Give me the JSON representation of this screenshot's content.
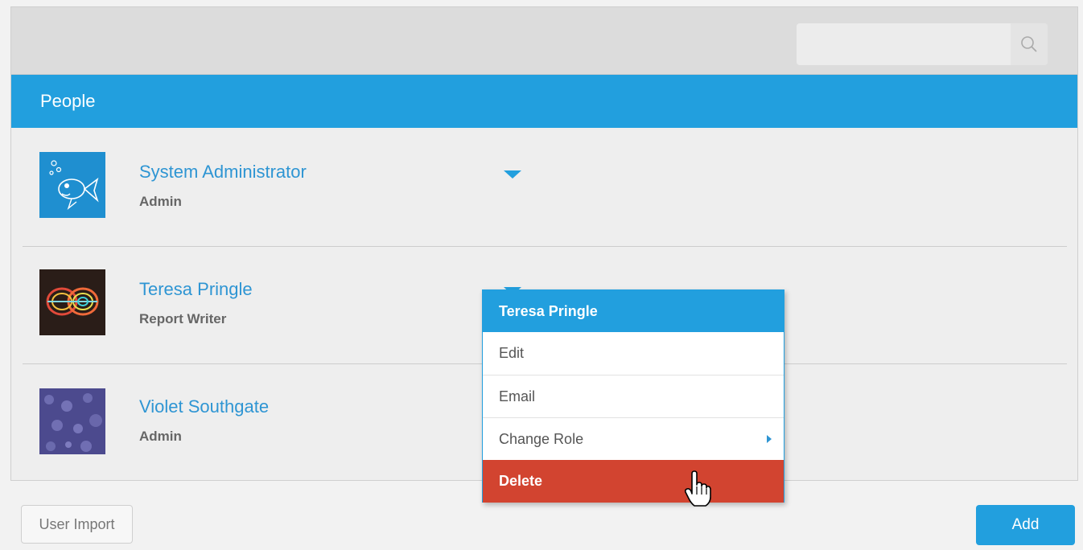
{
  "search": {
    "placeholder": "",
    "value": "",
    "icon": "search-icon"
  },
  "section": {
    "title": "People"
  },
  "people": [
    {
      "name": "System Administrator",
      "role": "Admin",
      "avatar": "fish-avatar"
    },
    {
      "name": "Teresa Pringle",
      "role": "Report Writer",
      "avatar": "light-rings-avatar"
    },
    {
      "name": "Violet Southgate",
      "role": "Admin",
      "avatar": "purple-bokeh-avatar"
    }
  ],
  "context_menu": {
    "title": "Teresa Pringle",
    "items": [
      {
        "label": "Edit"
      },
      {
        "label": "Email"
      },
      {
        "label": "Change Role",
        "has_submenu": true
      },
      {
        "label": "Delete",
        "highlighted": true
      }
    ]
  },
  "footer": {
    "import_label": "User Import",
    "add_label": "Add"
  },
  "colors": {
    "accent": "#229fde",
    "delete": "#d24430",
    "name_link": "#2e95d3"
  }
}
